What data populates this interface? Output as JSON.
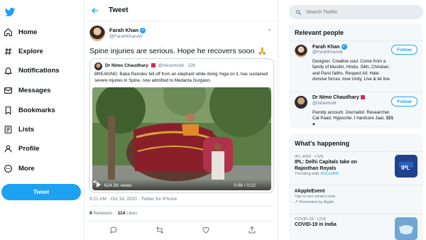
{
  "nav": {
    "items": [
      {
        "label": "Home",
        "icon": "home-icon"
      },
      {
        "label": "Explore",
        "icon": "hashtag-icon"
      },
      {
        "label": "Notifications",
        "icon": "bell-icon"
      },
      {
        "label": "Messages",
        "icon": "envelope-icon"
      },
      {
        "label": "Bookmarks",
        "icon": "bookmark-icon"
      },
      {
        "label": "Lists",
        "icon": "list-icon"
      },
      {
        "label": "Profile",
        "icon": "person-icon"
      },
      {
        "label": "More",
        "icon": "more-circle-icon"
      }
    ],
    "tweet_button": "Tweet"
  },
  "header": {
    "title": "Tweet"
  },
  "tweet": {
    "author_name": "Farah Khan",
    "author_handle": "@FarahKhanAli",
    "text": "Spine injuries are serious. Hope he recovers soon",
    "emoji": "🙏",
    "quoted": {
      "author_name": "Dr Nimo Chaudhary",
      "author_handle": "@niiravmodi",
      "age": "22h",
      "text": "BREAKING: Baba Ramdev fell off from an elephant while doing Yoga on it, has sustained severe injuries in Spine, now admitted to Medanta Gurgaon.",
      "video": {
        "views": "624.5K views",
        "time": "0:08 / 0:22"
      }
    },
    "timestamp": "9:21 AM · Oct 14, 2020 · Twitter for iPhone",
    "retweets": "9",
    "retweets_label": "Retweets",
    "likes": "114",
    "likes_label": "Likes"
  },
  "search": {
    "placeholder": "Search Twitter"
  },
  "relevant_people": {
    "title": "Relevant people",
    "people": [
      {
        "name": "Farah Khan",
        "handle": "@FarahKhanAli",
        "bio": "Designer. Creative soul. Come from a family of Muslim, Hindu, Sikh, Christian, and Parsi faiths. Respect All. Hate divisive forces. love Unity, Live & let live",
        "follow": "Follow"
      },
      {
        "name": "Dr Nimo Chaudhary",
        "handle": "@niiravmodi",
        "bio": "Parody account. Journalist. Researcher. Cat Paad. Hypocrite. I hardcore Jaat. $$$ ♥",
        "follow": "Follow"
      }
    ]
  },
  "whats_happening": {
    "title": "What's happening",
    "trends": [
      {
        "meta": "IPL 2020 · LIVE",
        "title": "IPL: Delhi Capitals take on",
        "title2": "Rajasthan Royals",
        "sub": "Trending with",
        "tag": "#DCvsRR"
      },
      {
        "meta": "",
        "title": "#AppleEvent",
        "title2": "",
        "sub": "Tap to see what's new",
        "tag": ""
      },
      {
        "meta": "",
        "title": "",
        "title2": "",
        "sub": "Promoted by Apple",
        "tag": ""
      },
      {
        "meta": "COVID-19 · LIVE",
        "title": "COVID-19 in India",
        "title2": "",
        "sub": "",
        "tag": ""
      }
    ]
  },
  "colors": {
    "accent": "#1da1f2",
    "text": "#0f1419",
    "muted": "#657786",
    "border": "#e6ecf0"
  }
}
